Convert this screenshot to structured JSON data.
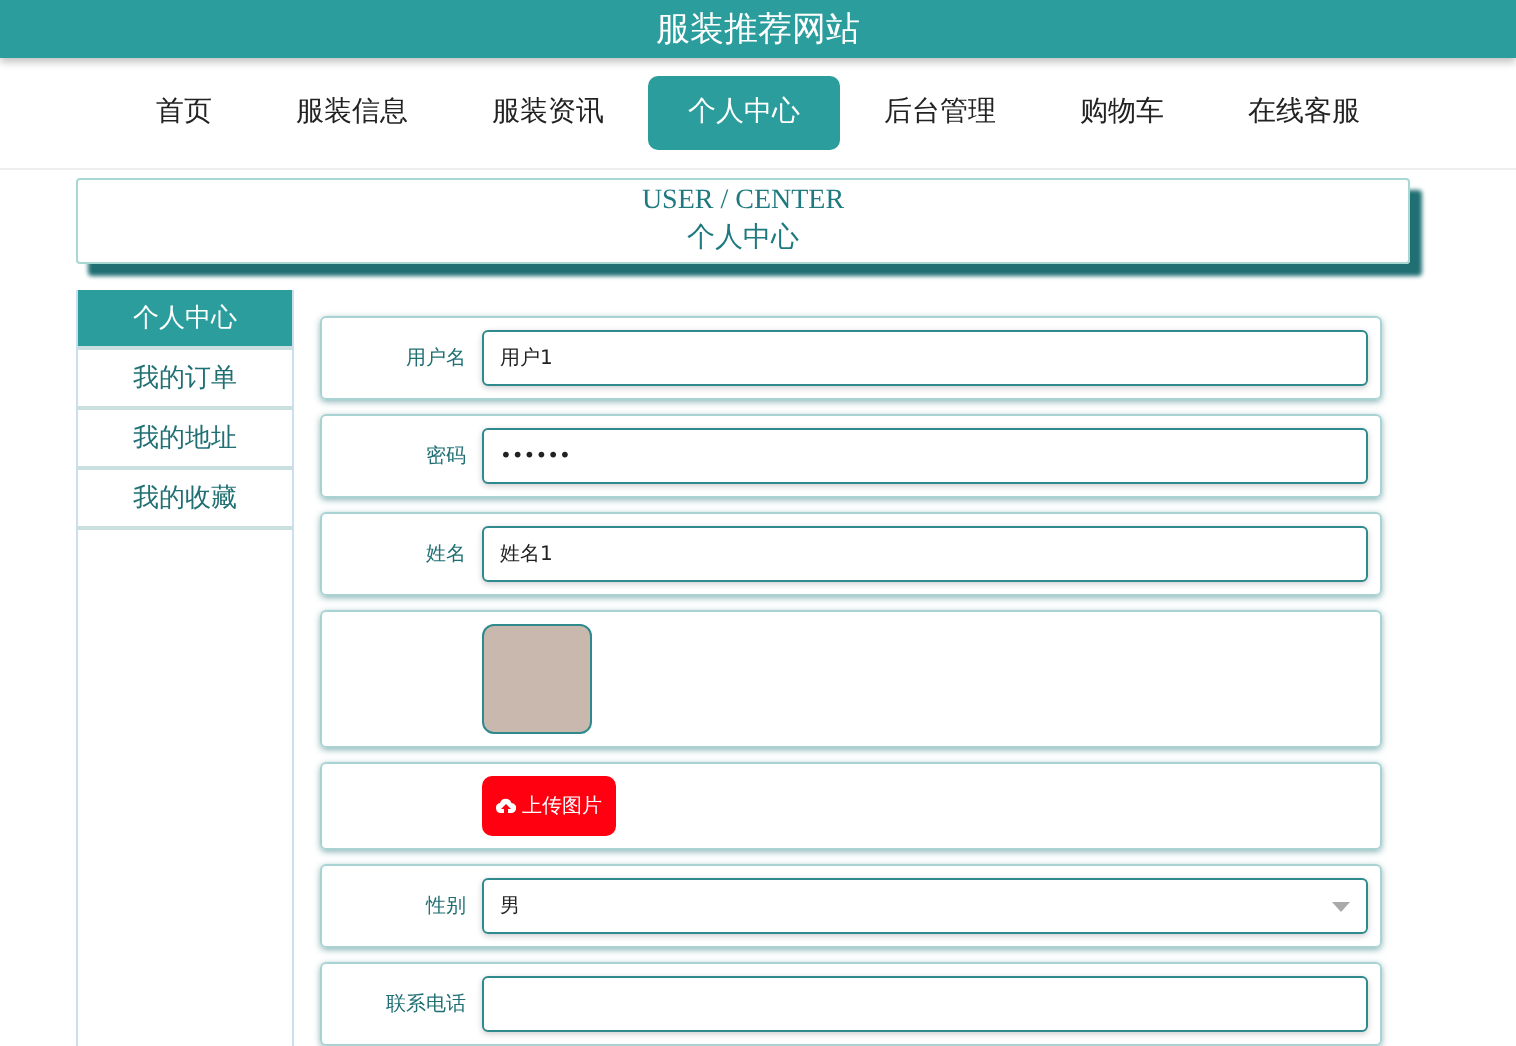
{
  "site_title": "服装推荐网站",
  "nav": [
    {
      "label": "首页",
      "selected": false
    },
    {
      "label": "服装信息",
      "selected": false
    },
    {
      "label": "服装资讯",
      "selected": false
    },
    {
      "label": "个人中心",
      "selected": true
    },
    {
      "label": "后台管理",
      "selected": false
    },
    {
      "label": "购物车",
      "selected": false
    },
    {
      "label": "在线客服",
      "selected": false
    }
  ],
  "banner": {
    "title_en": "USER / CENTER",
    "title_cn": "个人中心"
  },
  "sidebar": [
    {
      "label": "个人中心",
      "selected": true
    },
    {
      "label": "我的订单",
      "selected": false
    },
    {
      "label": "我的地址",
      "selected": false
    },
    {
      "label": "我的收藏",
      "selected": false
    }
  ],
  "form": [
    {
      "kind": "input",
      "label": "用户名",
      "value": "用户1"
    },
    {
      "kind": "input",
      "label": "密码",
      "value": "••••••"
    },
    {
      "kind": "input",
      "label": "姓名",
      "value": "姓名1"
    },
    {
      "kind": "photo"
    },
    {
      "kind": "upload",
      "button": "上传图片"
    },
    {
      "kind": "select",
      "label": "性别",
      "value": "男"
    },
    {
      "kind": "input",
      "label": "联系电话"
    }
  ]
}
